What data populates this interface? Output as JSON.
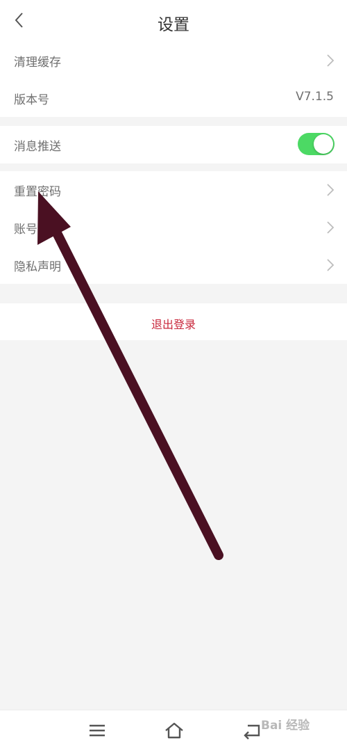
{
  "header": {
    "title": "设置",
    "back_icon": "chevron-left-icon"
  },
  "settings": {
    "group1": [
      {
        "label": "清理缓存",
        "has_chevron": true
      },
      {
        "label": "版本号",
        "value": "V7.1.5"
      }
    ],
    "group2": [
      {
        "label": "消息推送",
        "toggle_on": true
      }
    ],
    "group3": [
      {
        "label": "重置密码",
        "has_chevron": true
      },
      {
        "label": "账号",
        "has_chevron": true
      },
      {
        "label": "隐私声明",
        "has_chevron": true
      }
    ]
  },
  "logout": {
    "label": "退出登录"
  },
  "navbar": {
    "items": [
      "menu-icon",
      "home-icon",
      "back-icon"
    ]
  },
  "watermark": {
    "text": "Bai 经验"
  },
  "colors": {
    "toggle_on": "#4cd964",
    "logout_text": "#c8263a",
    "annotation_arrow": "#4a1022",
    "background": "#f4f4f4"
  }
}
